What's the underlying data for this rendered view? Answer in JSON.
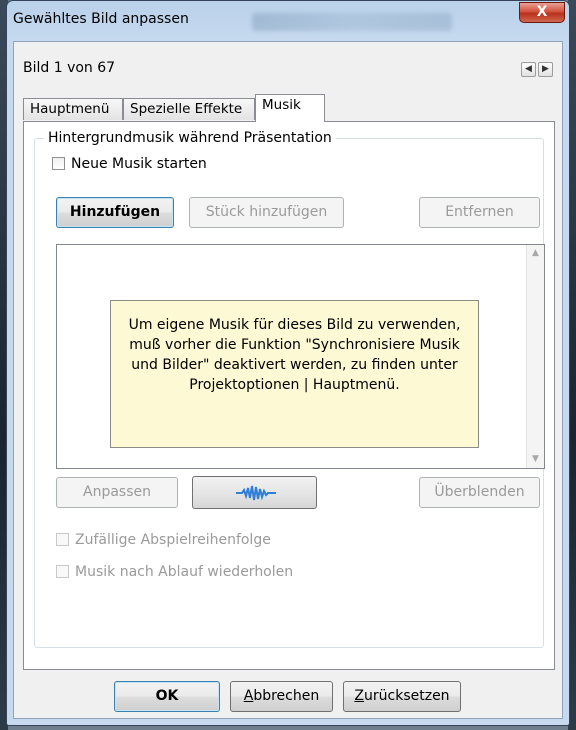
{
  "window": {
    "title": "Gewähltes Bild anpassen",
    "close_label": "X"
  },
  "header": {
    "counter": "Bild 1 von 67"
  },
  "tabs": [
    {
      "label": "Hauptmenü"
    },
    {
      "label": "Spezielle Effekte"
    },
    {
      "label": "Musik",
      "active": true
    }
  ],
  "music": {
    "group_title": "Hintergrundmusik während Präsentation",
    "new_music_label": "Neue Musik starten",
    "new_music_checked": false,
    "buttons": {
      "add": "Hinzufügen",
      "add_track": "Stück hinzufügen",
      "remove": "Entfernen",
      "adjust": "Anpassen",
      "crossfade": "Überblenden"
    },
    "info_text": "Um eigene Musik für dieses Bild zu verwenden, muß vorher die Funktion \"Synchronisiere Musik und Bilder\" deaktivert werden, zu finden unter Projektoptionen | Hauptmenü.",
    "random_order_label": "Zufällige Abspielreihenfolge",
    "repeat_label": "Musik nach Ablauf wiederholen"
  },
  "footer": {
    "ok_label": "OK",
    "cancel_label": "Abbrechen",
    "cancel_underline": "A",
    "cancel_rest": "bbrechen",
    "reset_underline": "Z",
    "reset_rest": "urücksetzen"
  },
  "icons": {
    "wave": "audio-waveform-icon"
  },
  "colors": {
    "info_bg": "#fdf9d5",
    "wave": "#2f7ed8",
    "close": "#c8402a"
  }
}
